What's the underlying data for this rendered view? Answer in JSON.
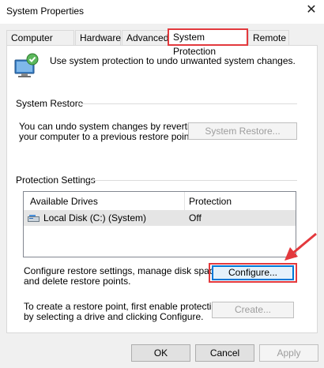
{
  "window": {
    "title": "System Properties"
  },
  "tabs": [
    "Computer Name",
    "Hardware",
    "Advanced",
    "System Protection",
    "Remote"
  ],
  "intro_text": "Use system protection to undo unwanted system changes.",
  "system_restore": {
    "heading": "System Restore",
    "description_line1": "You can undo system changes by reverting",
    "description_line2": "your computer to a previous restore point.",
    "button_label": "System Restore..."
  },
  "protection_settings": {
    "heading": "Protection Settings",
    "columns": [
      "Available Drives",
      "Protection"
    ],
    "rows": [
      {
        "drive": "Local Disk (C:) (System)",
        "protection": "Off"
      }
    ]
  },
  "configure": {
    "line1": "Configure restore settings, manage disk space,",
    "line2": "and delete restore points.",
    "button_label": "Configure..."
  },
  "create": {
    "line1": "To create a restore point, first enable protection",
    "line2": "by selecting a drive and clicking Configure.",
    "button_label": "Create..."
  },
  "footer": {
    "ok_label": "OK",
    "cancel_label": "Cancel",
    "apply_label": "Apply"
  },
  "colors": {
    "annotation": "#e3393d",
    "focus": "#0078d7"
  }
}
